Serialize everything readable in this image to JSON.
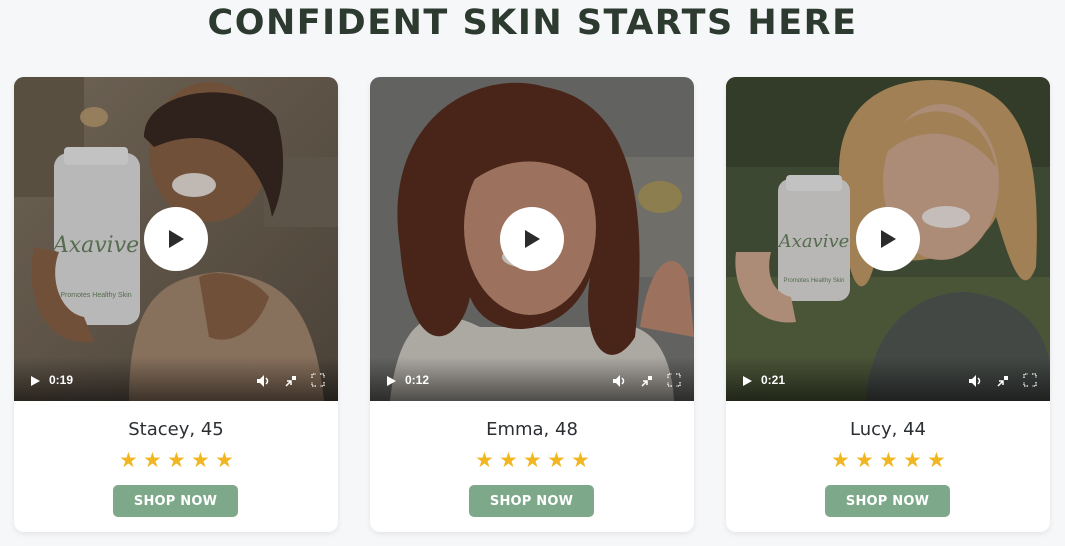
{
  "page": {
    "heading": "CONFIDENT SKIN STARTS HERE"
  },
  "colors": {
    "heading": "#2c3a30",
    "background": "#f6f7f9",
    "star": "#f2b621",
    "button": "#7ea88a",
    "button_text": "#ffffff"
  },
  "testimonials": [
    {
      "name": "Stacey, 45",
      "video_time": "0:19",
      "rating": 5,
      "stars": [
        "★",
        "★",
        "★",
        "★",
        "★"
      ],
      "button_label": "SHOP NOW",
      "product_logo": "Axavive",
      "product_tagline": "Promotes Healthy Skin"
    },
    {
      "name": "Emma, 48",
      "video_time": "0:12",
      "rating": 5,
      "stars": [
        "★",
        "★",
        "★",
        "★",
        "★"
      ],
      "button_label": "SHOP NOW"
    },
    {
      "name": "Lucy, 44",
      "video_time": "0:21",
      "rating": 5,
      "stars": [
        "★",
        "★",
        "★",
        "★",
        "★"
      ],
      "button_label": "SHOP NOW",
      "product_logo": "Axavive",
      "product_tagline": "Promotes Healthy Skin"
    }
  ],
  "icons": {
    "play": "play-icon",
    "volume": "volume-icon",
    "pip": "picture-in-picture-icon",
    "fullscreen": "fullscreen-icon"
  }
}
